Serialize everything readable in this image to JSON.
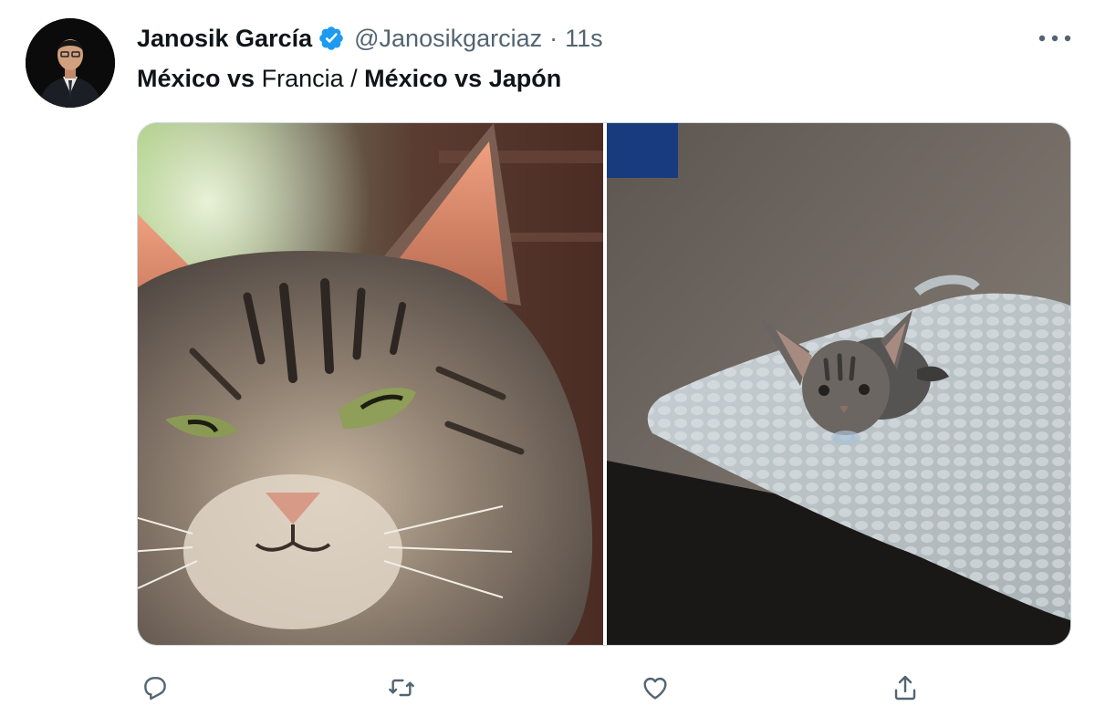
{
  "tweet": {
    "author": {
      "display_name": "Janosik García",
      "handle": "@Janosikgarciaz",
      "verified": true,
      "avatar_icon": "profile-photo"
    },
    "separator": "·",
    "timestamp": "11s",
    "text": {
      "part1": "México vs",
      "part2": " Francia / ",
      "part3": "México vs Japón"
    },
    "media": [
      {
        "icon": "adult-tabby-cat-photo"
      },
      {
        "icon": "tabby-kitten-on-blanket-photo"
      }
    ],
    "actions": [
      {
        "name": "reply",
        "icon": "reply-icon"
      },
      {
        "name": "retweet",
        "icon": "retweet-icon"
      },
      {
        "name": "like",
        "icon": "heart-icon"
      },
      {
        "name": "share",
        "icon": "share-icon"
      }
    ]
  },
  "colors": {
    "text_primary": "#0f1419",
    "text_secondary": "#536471",
    "verified_blue": "#1d9bf0",
    "border": "#cfd9de"
  }
}
